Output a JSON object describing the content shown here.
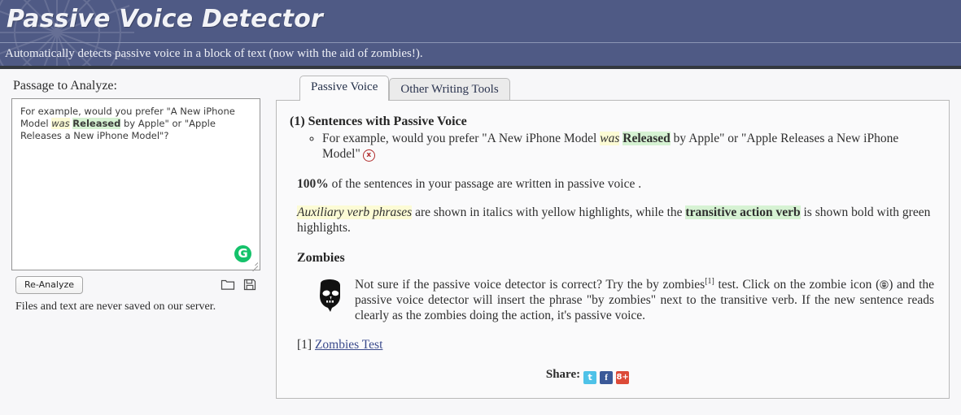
{
  "header": {
    "title": "Passive Voice Detector",
    "subtitle": "Automatically detects passive voice in a block of text (now with the aid of zombies!)."
  },
  "left_panel": {
    "passage_label": "Passage to Analyze:",
    "passage": {
      "before": "For example, would you prefer \"A New iPhone Model ",
      "aux": "was",
      "space": " ",
      "verb": "Released",
      "after": " by Apple\" or \"Apple Releases a New iPhone Model\"?"
    },
    "grammarly_badge": "G",
    "reanalyze_label": "Re-Analyze",
    "open_file_title": "Open file",
    "save_file_title": "Save file",
    "privacy_note": "Files and text are never saved on our server."
  },
  "tabs": [
    {
      "label": "Passive Voice",
      "active": true
    },
    {
      "label": "Other Writing Tools",
      "active": false
    }
  ],
  "results": {
    "section_title": "(1) Sentences with Passive Voice",
    "sentence": {
      "before": "For example, would you prefer \"A New iPhone Model ",
      "aux": "was",
      "space": " ",
      "verb": "Released",
      "after": " by Apple\" or \"Apple Releases a New iPhone Model\""
    },
    "dismiss_icon_label": "x",
    "stat": {
      "percent": "100%",
      "text": " of the sentences in your passage are written in passive voice ."
    },
    "legend": {
      "aux_phrase": "Auxiliary verb phrases",
      "mid": " are shown in italics with yellow highlights, while the ",
      "verb_phrase": "transitive action verb",
      "tail": " is shown bold with green highlights."
    },
    "zombies_heading": "Zombies",
    "zombies_text": {
      "p1": "Not sure if the passive voice detector is correct? Try the by zombies",
      "sup": "[1]",
      "p2": " test. Click on the zombie icon (",
      "p3": ") and the passive voice detector will insert the phrase \"by zombies\" next to the transitive verb. If the new sentence reads clearly as the zombies doing the action, it's passive voice."
    },
    "footnote_marker": "[1] ",
    "footnote_link": "Zombies Test",
    "share_label": "Share:",
    "share_icons": [
      {
        "name": "twitter",
        "glyph": "t"
      },
      {
        "name": "facebook",
        "glyph": "f"
      },
      {
        "name": "googleplus",
        "glyph": "8+"
      }
    ]
  },
  "colors": {
    "header_bg": "#4f5a85",
    "aux_highlight": "#fcfbd5",
    "verb_highlight": "#d6f2d3",
    "grammarly_green": "#15c26b",
    "dismiss_red": "#b02a2a"
  }
}
